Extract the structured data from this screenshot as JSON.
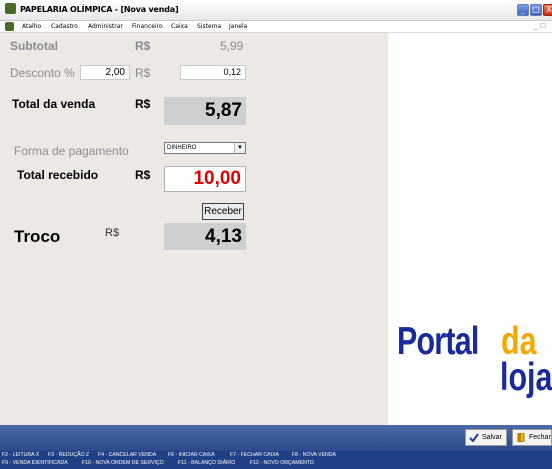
{
  "window": {
    "title": "PAPELARIA OLÍMPICA - [Nova venda]",
    "min": "_",
    "max": "□",
    "close": "X"
  },
  "menu": {
    "items": [
      "Atalho",
      "Cadastro",
      "Administrar",
      "Financeiro",
      "Caixa",
      "Sistema",
      "Janela"
    ],
    "mdi": "_ ☐"
  },
  "sale": {
    "subtotal_label": "Subtotal",
    "subtotal_currency": "R$",
    "subtotal_value": "5,99",
    "desconto_label": "Desconto %",
    "desconto_percent": "2,00",
    "desconto_currency": "R$",
    "desconto_value": "0,12",
    "total_label": "Total da venda",
    "total_currency": "R$",
    "total_value": "5,87",
    "forma_label": "Forma de pagamento",
    "forma_selected": "DINHEIRO",
    "recebido_label": "Total recebido",
    "recebido_currency": "R$",
    "recebido_value": "10,00",
    "receber_button": "Receber",
    "troco_label": "Troco",
    "troco_currency": "R$",
    "troco_value": "4,13"
  },
  "logo": {
    "portal": "Portal",
    "da": "da",
    "loja": "loja"
  },
  "toolbar": {
    "salvar": "Salvar",
    "fechar": "Fechar"
  },
  "shortcuts": {
    "row1": [
      "F2 - LEITURA X",
      "F3 - REDUÇÃO Z",
      "F4 - CANCELAR VENDA",
      "F6 - INICIAR CAIXA",
      "F7 - FECHAR CAIXA",
      "F8 - NOVA VENDA"
    ],
    "row2": [
      "F9 - VENDA IDENTIFICADA",
      "F10 - NOVA ORDEM DE SERVIÇO",
      "F11 - BALANÇO DIÁRIO",
      "F12 - NOVO ORÇAMENTO"
    ]
  },
  "colors": {
    "received": "#e00000",
    "brand_blue": "#1a2a9a",
    "brand_orange": "#f5a800"
  }
}
